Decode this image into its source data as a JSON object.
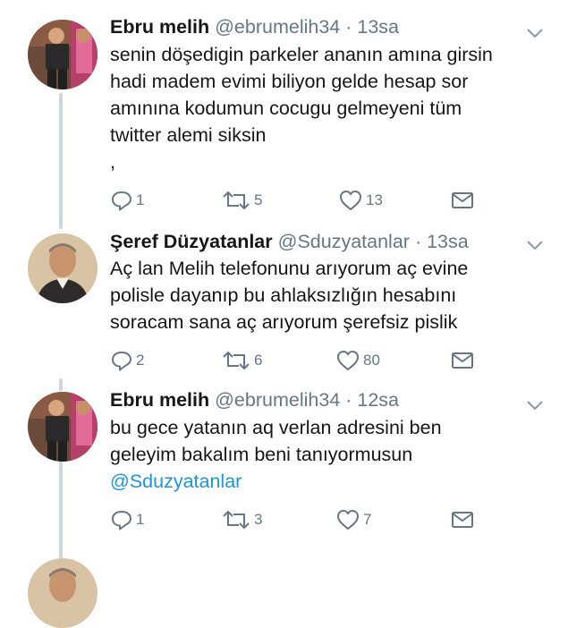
{
  "tweets": [
    {
      "name": "Ebru melih",
      "handle": "@ebrumelih34",
      "separator": "·",
      "time": "13sa",
      "lines": [
        "senin döşedigin parkeler ananın amına girsin",
        "hadi madem evimi biliyon gelde hesap sor",
        "amınına kodumun cocugu gelmeyeni tüm",
        "twitter alemi siksin",
        ","
      ],
      "replies": "1",
      "retweets": "5",
      "likes": "13"
    },
    {
      "name": "Şeref Düzyatanlar",
      "handle": "@Sduzyatanlar",
      "separator": "·",
      "time": "13sa",
      "lines": [
        "Aç lan Melih telefonunu arıyorum aç evine",
        "polisle dayanıp bu ahlaksızlığın hesabını",
        "soracam sana aç arıyorum şerefsiz pislik"
      ],
      "replies": "2",
      "retweets": "6",
      "likes": "80"
    },
    {
      "name": "Ebru melih",
      "handle": "@ebrumelih34",
      "separator": "·",
      "time": "12sa",
      "lines": [
        "bu gece yatanın aq verlan adresini ben",
        "geleyim bakalım beni tanıyormusun"
      ],
      "mention": "@Sduzyatanlar",
      "replies": "1",
      "retweets": "3",
      "likes": "7"
    }
  ],
  "colors": {
    "text": "#14171a",
    "secondary": "#657786",
    "link": "#1b95e0",
    "thread_line": "#ccd6dd"
  },
  "icons": [
    "reply-icon",
    "retweet-icon",
    "like-icon",
    "direct-message-icon",
    "chevron-down-icon"
  ]
}
